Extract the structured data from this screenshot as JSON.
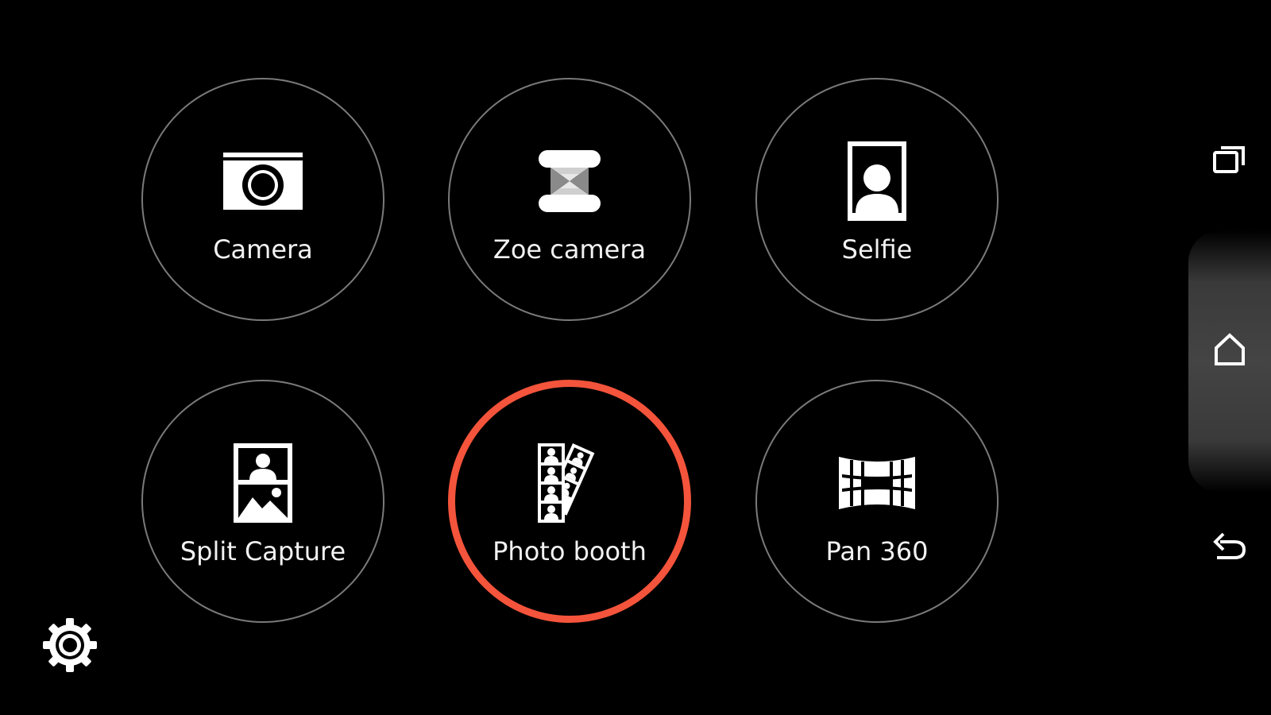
{
  "modes": [
    {
      "label": "Camera",
      "icon": "camera-icon",
      "selected": false
    },
    {
      "label": "Zoe camera",
      "icon": "zoe-camera-icon",
      "selected": false
    },
    {
      "label": "Selfie",
      "icon": "selfie-icon",
      "selected": false
    },
    {
      "label": "Split Capture",
      "icon": "split-capture-icon",
      "selected": false
    },
    {
      "label": "Photo booth",
      "icon": "photo-booth-icon",
      "selected": true
    },
    {
      "label": "Pan 360",
      "icon": "pan-360-icon",
      "selected": false
    }
  ],
  "colors": {
    "background": "#000000",
    "ring": "#7a7a7a",
    "selected_ring": "#f4543b",
    "text": "#f2f2f2"
  },
  "nav": {
    "recent": "recent-apps-icon",
    "home": "home-icon",
    "back": "back-icon"
  },
  "settings": "gear-icon"
}
